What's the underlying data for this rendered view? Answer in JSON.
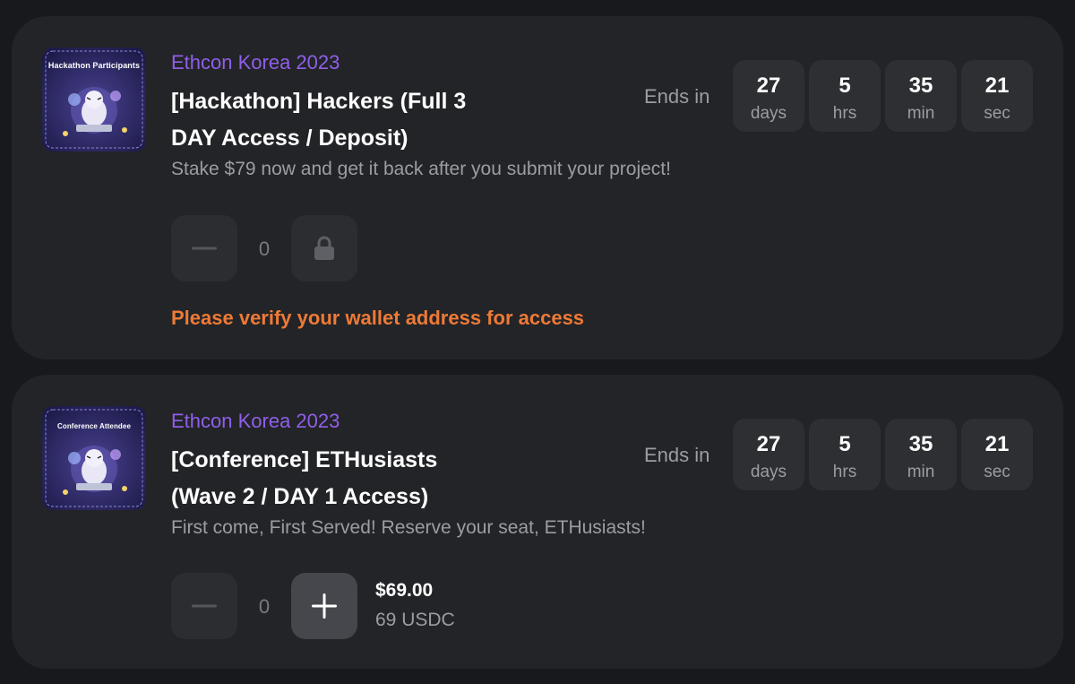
{
  "tickets": [
    {
      "thumbnail_label": "Hackathon Participants",
      "organizer": "Ethcon Korea 2023",
      "title_line1": "[Hackathon] Hackers (Full 3",
      "title_line2": "DAY Access / Deposit)",
      "description": "Stake $79 now and get it back after you submit your project!",
      "ends_in_label": "Ends in",
      "countdown": [
        {
          "value": "27",
          "unit": "days"
        },
        {
          "value": "5",
          "unit": "hrs"
        },
        {
          "value": "35",
          "unit": "min"
        },
        {
          "value": "21",
          "unit": "sec"
        }
      ],
      "quantity": "0",
      "locked": true,
      "notice": "Please verify your wallet address for access"
    },
    {
      "thumbnail_label": "Conference Attendee",
      "organizer": "Ethcon Korea 2023",
      "title_line1": "[Conference] ETHusiasts",
      "title_line2": "(Wave 2 / DAY 1 Access)",
      "description": "First come, First Served! Reserve your seat, ETHusiasts!",
      "ends_in_label": "Ends in",
      "countdown": [
        {
          "value": "27",
          "unit": "days"
        },
        {
          "value": "5",
          "unit": "hrs"
        },
        {
          "value": "35",
          "unit": "min"
        },
        {
          "value": "21",
          "unit": "sec"
        }
      ],
      "quantity": "0",
      "locked": false,
      "price": "$69.00",
      "price_crypto": "69 USDC"
    }
  ],
  "colors": {
    "background": "#18191c",
    "card": "#232427",
    "organizer": "#8f5fea",
    "notice": "#ee7a36",
    "muted_text": "#9c9da1"
  },
  "icons": [
    "minus-icon",
    "lock-icon",
    "plus-icon"
  ]
}
